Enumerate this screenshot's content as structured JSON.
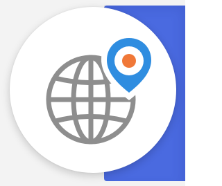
{
  "icon": {
    "name": "globe-with-location-pin",
    "globe_icon": "globe-icon",
    "pin_icon": "location-pin-icon"
  },
  "colors": {
    "background": "#f3f3f3",
    "accent_panel": "#4a6ae0",
    "circle": "#ffffff",
    "globe_stroke": "#8e8e8e",
    "pin_blue": "#2f8de0",
    "pin_center": "#f07838"
  }
}
